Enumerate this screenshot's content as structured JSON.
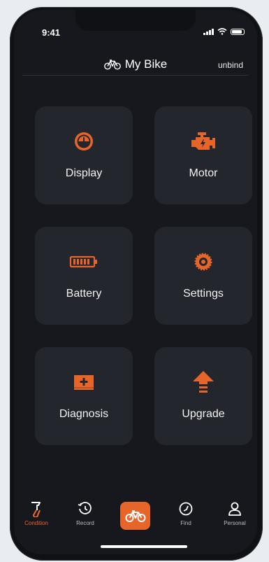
{
  "status": {
    "time": "9:41"
  },
  "header": {
    "title": "My Bike",
    "unbind_label": "unbind"
  },
  "tiles": [
    {
      "label": "Display",
      "icon": "speedometer-icon"
    },
    {
      "label": "Motor",
      "icon": "engine-icon"
    },
    {
      "label": "Battery",
      "icon": "battery-icon"
    },
    {
      "label": "Settings",
      "icon": "gear-icon"
    },
    {
      "label": "Diagnosis",
      "icon": "medical-kit-icon"
    },
    {
      "label": "Upgrade",
      "icon": "upgrade-arrow-icon"
    }
  ],
  "tabbar": {
    "items": [
      {
        "label": "Condition",
        "icon": "wrench-icon",
        "active": true
      },
      {
        "label": "Record",
        "icon": "record-clock-icon"
      },
      {
        "label": "",
        "icon": "bike-icon"
      },
      {
        "label": "Find",
        "icon": "compass-icon"
      },
      {
        "label": "Personal",
        "icon": "person-icon"
      }
    ]
  },
  "colors": {
    "accent": "#e8652a",
    "tile": "#24262e",
    "background": "#16181d"
  }
}
